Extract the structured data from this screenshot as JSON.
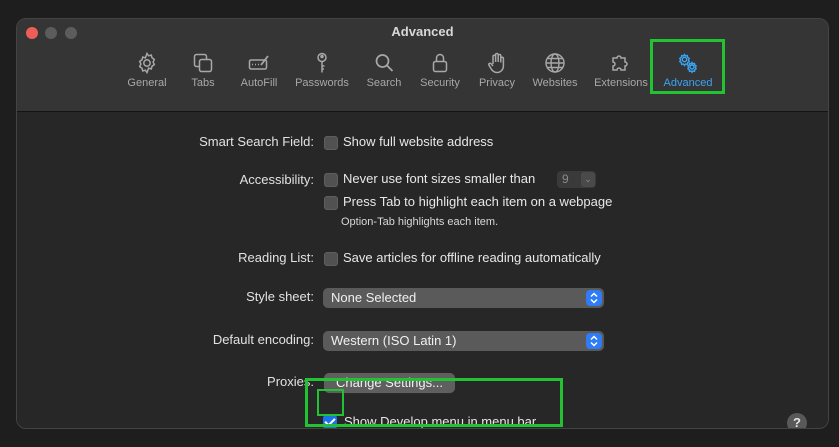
{
  "window": {
    "title": "Advanced"
  },
  "toolbar": {
    "items": [
      {
        "label": "General",
        "icon": "gear-icon"
      },
      {
        "label": "Tabs",
        "icon": "tabs-icon"
      },
      {
        "label": "AutoFill",
        "icon": "autofill-icon"
      },
      {
        "label": "Passwords",
        "icon": "key-icon"
      },
      {
        "label": "Search",
        "icon": "search-icon"
      },
      {
        "label": "Security",
        "icon": "lock-icon"
      },
      {
        "label": "Privacy",
        "icon": "hand-icon"
      },
      {
        "label": "Websites",
        "icon": "globe-icon"
      },
      {
        "label": "Extensions",
        "icon": "puzzle-icon"
      },
      {
        "label": "Advanced",
        "icon": "gears-icon",
        "active": true
      }
    ]
  },
  "settings": {
    "smart_search": {
      "label": "Smart Search Field:",
      "option": "Show full website address",
      "checked": false
    },
    "accessibility": {
      "label": "Accessibility:",
      "font_option": "Never use font sizes smaller than",
      "font_size": "9",
      "font_checked": false,
      "tab_option": "Press Tab to highlight each item on a webpage",
      "tab_checked": false,
      "tab_note": "Option-Tab highlights each item."
    },
    "reading_list": {
      "label": "Reading List:",
      "option": "Save articles for offline reading automatically",
      "checked": false
    },
    "style_sheet": {
      "label": "Style sheet:",
      "value": "None Selected"
    },
    "default_encoding": {
      "label": "Default encoding:",
      "value": "Western (ISO Latin 1)"
    },
    "proxies": {
      "label": "Proxies:",
      "button": "Change Settings..."
    },
    "develop_menu": {
      "option": "Show Develop menu in menu bar",
      "checked": true
    }
  },
  "help": {
    "label": "?"
  },
  "colors": {
    "accent": "#3aa4f4",
    "highlight": "#22c232",
    "checkbox_checked": "#1a73e8"
  }
}
